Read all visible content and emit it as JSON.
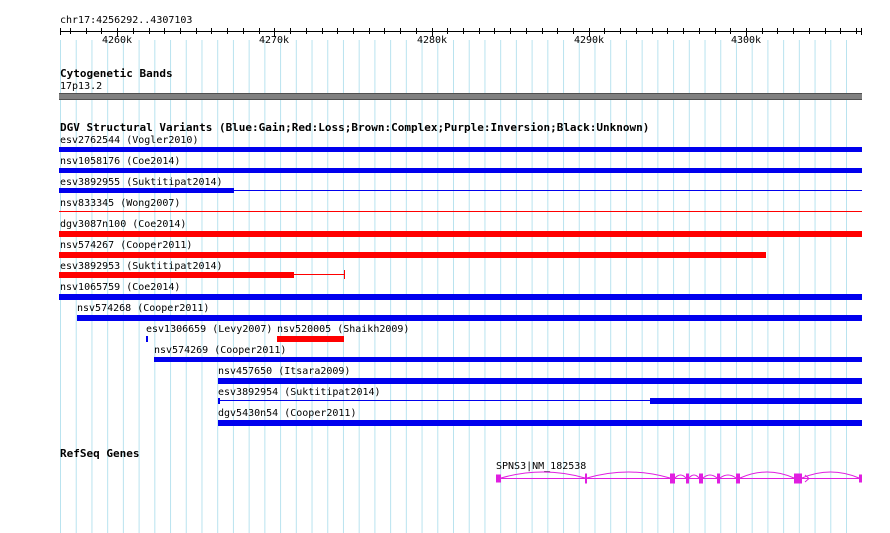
{
  "locus": "chr17:4256292..4307103",
  "ruler": {
    "ticks": [
      "4260k",
      "4270k",
      "4280k",
      "4290k",
      "4300k"
    ]
  },
  "cytoband": {
    "header": "Cytogenetic Bands",
    "band": "17p13.2"
  },
  "dgv": {
    "header": "DGV Structural Variants (Blue:Gain;Red:Loss;Brown:Complex;Purple:Inversion;Black:Unknown)",
    "colors": {
      "gain": "#0000ee",
      "loss": "#ff0000",
      "complex": "#8b4513",
      "inversion": "#800080",
      "unknown": "#000000"
    },
    "features": [
      {
        "label": "esv2762544 (Vogler2010)",
        "type": "gain"
      },
      {
        "label": "nsv1058176 (Coe2014)",
        "type": "gain"
      },
      {
        "label": "esv3892955 (Suktitipat2014)",
        "type": "gain"
      },
      {
        "label": "nsv833345 (Wong2007)",
        "type": "loss"
      },
      {
        "label": "dgv3087n100 (Coe2014)",
        "type": "loss"
      },
      {
        "label": "nsv574267 (Cooper2011)",
        "type": "loss"
      },
      {
        "label": "esv3892953 (Suktitipat2014)",
        "type": "loss"
      },
      {
        "label": "nsv1065759 (Coe2014)",
        "type": "gain"
      },
      {
        "label": "nsv574268 (Cooper2011)",
        "type": "gain"
      },
      {
        "label": "esv1306659 (Levy2007)",
        "type": "gain"
      },
      {
        "label": "nsv520005 (Shaikh2009)",
        "type": "loss"
      },
      {
        "label": "nsv574269 (Cooper2011)",
        "type": "gain"
      },
      {
        "label": "nsv457650 (Itsara2009)",
        "type": "gain"
      },
      {
        "label": "esv3892954 (Suktitipat2014)",
        "type": "gain"
      },
      {
        "label": "dgv5430n54 (Cooper2011)",
        "type": "gain"
      }
    ]
  },
  "refseq": {
    "header": "RefSeq Genes",
    "gene_label": "SPNS3|NM_182538",
    "color": "#e01ee0"
  }
}
